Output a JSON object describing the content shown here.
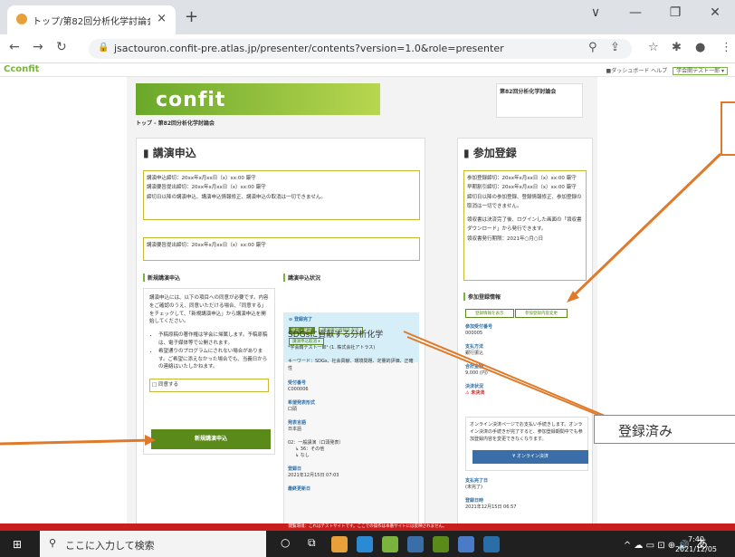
{
  "browser": {
    "tab_title": "トップ/第82回分析化学討論会 - Co",
    "tab_close": "×",
    "new_tab": "+",
    "window_controls": [
      "∨",
      "—",
      "❐",
      "✕"
    ],
    "url": "jsactouron.confit-pre.atlas.jp/presenter/contents?version=1.0&role=presenter",
    "icons": [
      "back-icon",
      "forward-icon",
      "reload-icon",
      "lock-icon",
      "zoom-icon",
      "share-icon",
      "star-icon",
      "extension-icon",
      "profile-icon",
      "menu-icon"
    ]
  },
  "site": {
    "logo": "Cconfit",
    "links": [
      "■ダッシュボード",
      "ヘルプ"
    ],
    "user_button": "学会開テスト一郎 ▾",
    "conference_box": "第82回分析化学討論会",
    "banner_logo": "confit",
    "breadcrumb": "トップ - 第82回分析化学討論会"
  },
  "left_panel": {
    "title": "講演申込",
    "notices1": [
      "講演申込締切：20xx年x月xx日（x）xx:00 厳守",
      "講演要旨提出締切：20xx年x月xx日（x）xx:00 厳守",
      "締切日以降の講演申込、講演申込情報修正、講演申込の取消は一切できません。"
    ],
    "notice2": "講演要旨提出締切：20xx年x月xx日（x）xx:00 厳守",
    "new_section_title": "新規講演申込",
    "new_section_text": "講演申込には、以下の項目への同意が必要です。内容をご確認のうえ、同意いただける場合、「同意する」をチェックして、「新規講演申込」から講演申込を開始してください。",
    "bullets": [
      "予稿原稿の著作権は学会に帰属します。予稿原稿は、電子媒体等で公開されます。",
      "希望通りのプログラムにされない場合があります。ご希望に添えなかった場合でも、当義日からの連絡はいたしかねます。"
    ],
    "agree_label": "□ 同意する",
    "new_button": "新規講演申込"
  },
  "status_section": {
    "title": "講演申込状況",
    "status": "登録完了",
    "buttons": [
      "修正・確認",
      "講演申込情報を表示",
      "講演申込取消 ▾"
    ],
    "talk_title": "SDGsに貢献する分析化学",
    "author": "*学会籍テスト一郎¹ (1. 株式会社アトラス)",
    "keywords": "キーワード：SDGs、社会貢献、環境問題、定量的評価、正確性",
    "fields": [
      {
        "label": "受付番号",
        "value": "C000006"
      },
      {
        "label": "希望発表形式",
        "value": "口頭"
      },
      {
        "label": "発表言語",
        "value": "日本語"
      },
      {
        "label": "",
        "value": "02：一般講演（口頭発表）"
      },
      {
        "label": "",
        "value": "↳ 36：その他"
      },
      {
        "label": "",
        "value": "↳ なし"
      },
      {
        "label": "登録日",
        "value": "2021年12月15日 07:03"
      },
      {
        "label": "最終更新日",
        "value": ""
      }
    ]
  },
  "right_panel": {
    "title": "参加登録",
    "notices": [
      "参加登録締切：20xx年x月xx日（x）xx:00 厳守",
      "早期割引締切：20xx年x月xx日（x）xx:00 厳守",
      "締切日以降の参加登録、登録情報修正、参加登録の取消は一切できません。",
      "領収書は決済完了後、ログインした画面の「領収書ダウンロード」から発行できます。",
      "領収書発行期限：2021年○月○日"
    ],
    "info_title": "参加登録情報",
    "buttons": [
      "登録情報を表示",
      "参加登録内容変更"
    ],
    "fields": [
      {
        "label": "参加受付番号",
        "value": "000005"
      },
      {
        "label": "支払方法",
        "value": "銀行振込"
      },
      {
        "label": "合計金額",
        "value": "9,000 (円)"
      },
      {
        "label": "決済状況",
        "value": "⚠ 未決済"
      }
    ],
    "online_notice": "オンライン決済ページでお支払い手続きします。オンライン決済の手続きが完了すると、参加登録期間中でも参加登録内容を変更できなくなります。",
    "online_button": "¥ オンライン決済",
    "paid_date_label": "支払完了日",
    "paid_date_value": "(未完了)",
    "registered_label": "登録日時",
    "registered_value": "2021年12月15日 06:57"
  },
  "callouts": {
    "registered": "登録済み"
  },
  "red_banner": "閲覧環境：これはテストサイトです。ここでの操作は本番サイトには反映されません。",
  "taskbar": {
    "search_placeholder": "ここに入力して検索",
    "tray_icons": "^ ☁ ▭ ⊡ ⊕ 🔊",
    "ime": "あ",
    "time": "7:40",
    "date": "2021/12/05"
  },
  "colors": {
    "brand_green": "#7ab33e",
    "callout_orange": "#e07a2a",
    "warning_red": "#c81e1e"
  }
}
